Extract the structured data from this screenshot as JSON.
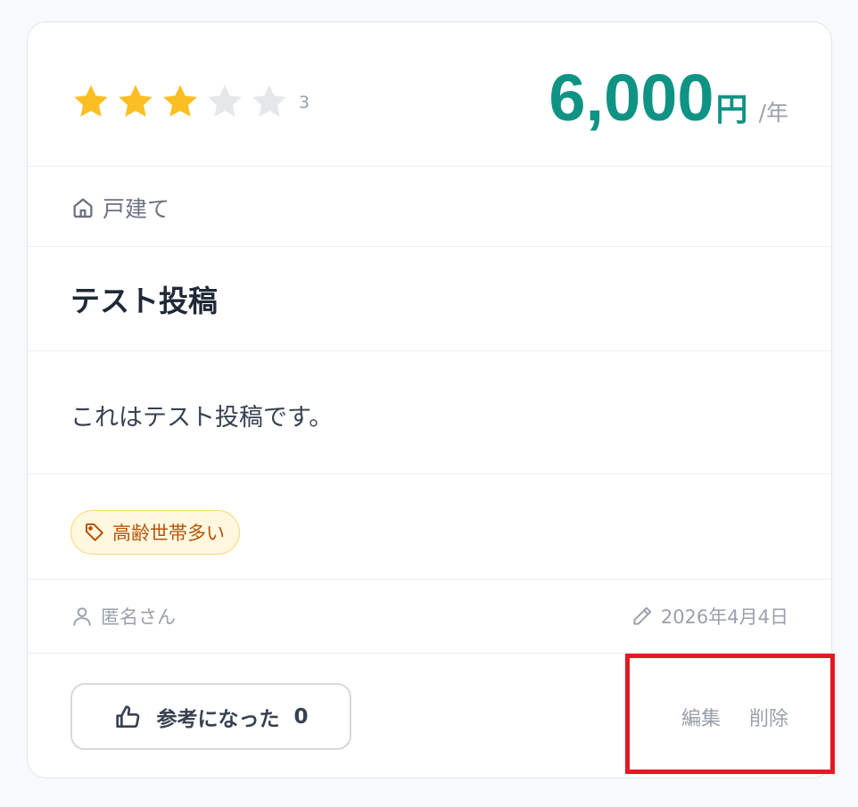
{
  "review": {
    "rating": {
      "value": 3,
      "max": 5,
      "label": "3",
      "filled_color": "#fbbf24",
      "empty_color": "#e5e7eb"
    },
    "price": {
      "amount": "6,000",
      "unit": "円",
      "period": "/年",
      "color": "#0f9384"
    },
    "property_type": {
      "icon": "home-icon",
      "label": "戸建て"
    },
    "title": "テスト投稿",
    "body": "これはテスト投稿です。",
    "tags": [
      {
        "icon": "tag-icon",
        "label": "高齢世帯多い"
      }
    ],
    "author": {
      "icon": "user-icon",
      "name": "匿名さん"
    },
    "date": {
      "icon": "pencil-icon",
      "text": "2026年4月4日"
    },
    "helpful": {
      "icon": "thumbs-up-icon",
      "label": "参考になった",
      "count": "0"
    },
    "actions": {
      "edit_label": "編集",
      "delete_label": "削除"
    }
  },
  "highlight_color": "#e01b24"
}
